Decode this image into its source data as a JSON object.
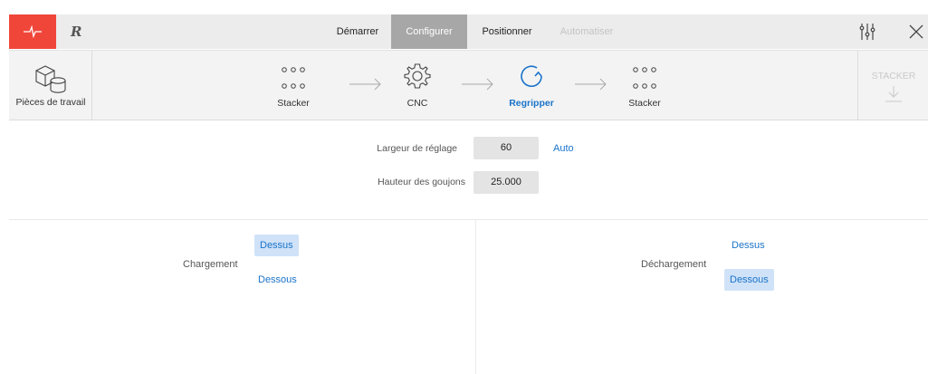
{
  "topbar": {
    "brand_icon": "heartbeat-icon",
    "logo_text": "R",
    "tabs": [
      {
        "label": "Démarrer",
        "state": "normal"
      },
      {
        "label": "Configurer",
        "state": "active"
      },
      {
        "label": "Positionner",
        "state": "normal"
      },
      {
        "label": "Automatiser",
        "state": "disabled"
      }
    ],
    "settings_icon": "sliders-icon",
    "close_icon": "close-icon"
  },
  "workflow": {
    "workpieces_label": "Pièces de travail",
    "steps": [
      {
        "label": "Stacker",
        "icon": "dots-grid-icon",
        "active": false
      },
      {
        "label": "CNC",
        "icon": "gear-icon",
        "active": false
      },
      {
        "label": "Regripper",
        "icon": "rotate-icon",
        "active": true
      },
      {
        "label": "Stacker",
        "icon": "dots-grid-icon",
        "active": false
      }
    ],
    "stacker_button_label": "STACKER"
  },
  "params": {
    "width_label": "Largeur de réglage",
    "width_value": "60",
    "auto_label": "Auto",
    "height_label": "Hauteur des goujons",
    "height_value": "25.000"
  },
  "loading": {
    "label": "Chargement",
    "options": [
      "Dessus",
      "Dessous"
    ],
    "selected": "Dessus"
  },
  "unloading": {
    "label": "Déchargement",
    "options": [
      "Dessus",
      "Dessous"
    ],
    "selected": "Dessous"
  },
  "colors": {
    "brand_red": "#f0463a",
    "active_tab": "#a7a7a7",
    "accent_blue": "#1a73c9",
    "selected_bg": "#cfe2f8"
  }
}
